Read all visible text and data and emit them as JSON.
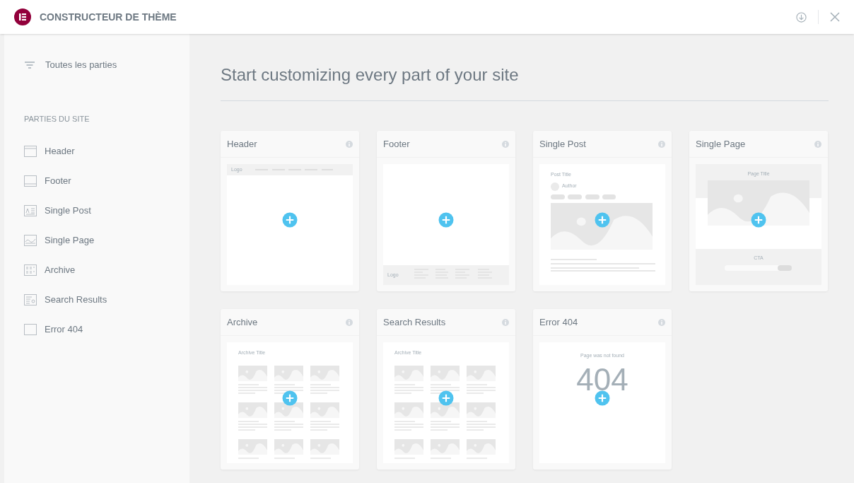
{
  "header": {
    "title": "CONSTRUCTEUR DE THÈME"
  },
  "sidebar": {
    "all_parts": "Toutes les parties",
    "section_title": "PARTIES DU SITE",
    "items": [
      {
        "label": "Header",
        "kind": "header"
      },
      {
        "label": "Footer",
        "kind": "footer"
      },
      {
        "label": "Single Post",
        "kind": "single-post"
      },
      {
        "label": "Single Page",
        "kind": "single-page"
      },
      {
        "label": "Archive",
        "kind": "archive"
      },
      {
        "label": "Search Results",
        "kind": "search"
      },
      {
        "label": "Error 404",
        "kind": "error"
      }
    ]
  },
  "main": {
    "title": "Start customizing every part of your site",
    "cards": [
      {
        "title": "Header",
        "kind": "header",
        "preview": {
          "logo": "Logo"
        }
      },
      {
        "title": "Footer",
        "kind": "footer",
        "preview": {
          "logo": "Logo"
        }
      },
      {
        "title": "Single Post",
        "kind": "single-post",
        "preview": {
          "title": "Post Title",
          "author": "Author"
        }
      },
      {
        "title": "Single Page",
        "kind": "single-page",
        "preview": {
          "title": "Page Title",
          "cta": "CTA"
        }
      },
      {
        "title": "Archive",
        "kind": "archive",
        "preview": {
          "title": "Archive Title"
        }
      },
      {
        "title": "Search Results",
        "kind": "archive",
        "preview": {
          "title": "Archive Title"
        }
      },
      {
        "title": "Error 404",
        "kind": "error",
        "preview": {
          "message": "Page was not found",
          "code": "404"
        }
      }
    ]
  }
}
